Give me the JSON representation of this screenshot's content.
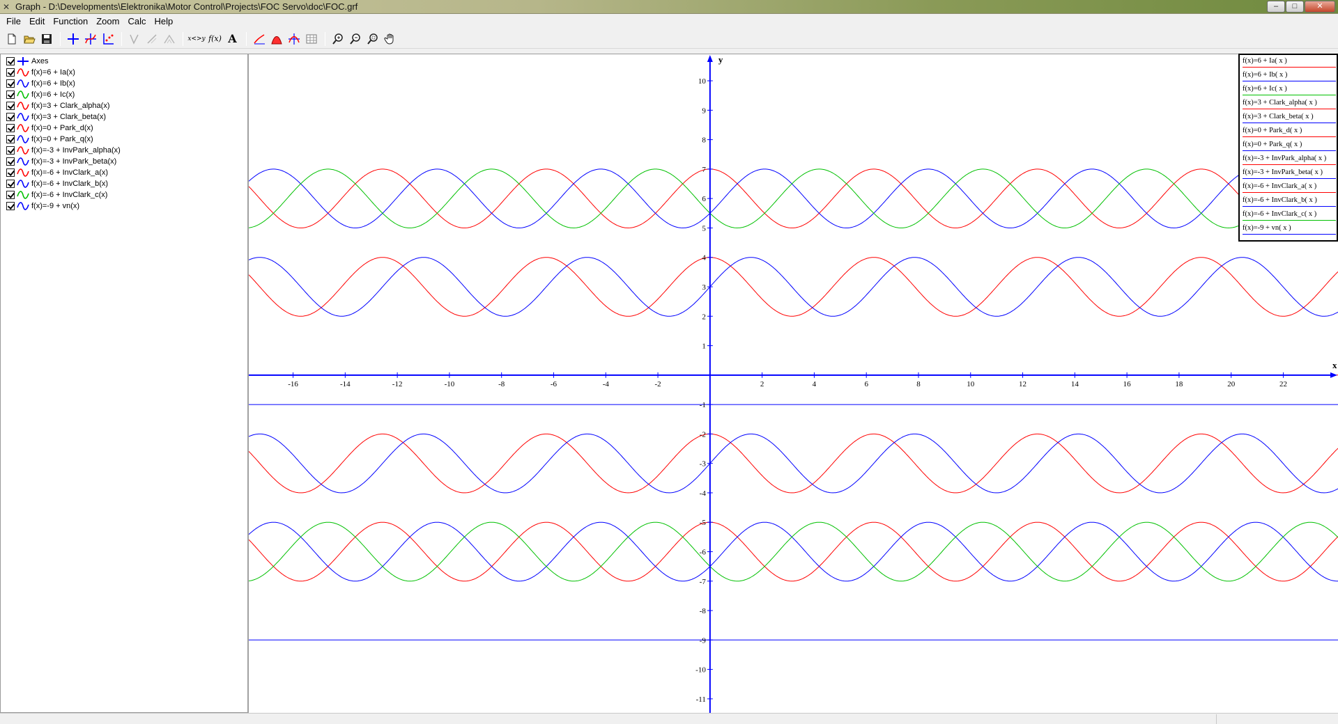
{
  "window": {
    "title": "Graph - D:\\Developments\\Elektronika\\Motor Control\\Projects\\FOC Servo\\doc\\FOC.grf",
    "minimize_label": "–",
    "maximize_label": "□",
    "close_label": "✕"
  },
  "menu": {
    "items": [
      "File",
      "Edit",
      "Function",
      "Zoom",
      "Calc",
      "Help"
    ]
  },
  "toolbar": {
    "swap_label": "x<>y",
    "fx_label": "f(x)",
    "text_label": "A",
    "buttons": [
      "new-icon",
      "open-icon",
      "save-icon",
      "insert-axes-icon",
      "insert-function-icon",
      "insert-point-series-icon",
      "tangent-icon",
      "shading-icon",
      "relation-icon",
      "swap-xy-icon",
      "fx-icon",
      "text-icon",
      "trendline-icon",
      "area-icon",
      "evaluate-icon",
      "table-icon",
      "zoom-in-icon",
      "zoom-out-icon",
      "zoom-window-icon",
      "pan-hand-icon"
    ]
  },
  "function_list": {
    "items": [
      {
        "label": "Axes",
        "color": "#0000ff",
        "icon": "axes-icon",
        "checked": true
      },
      {
        "label": "f(x)=6 + Ia(x)",
        "color": "#ff0000",
        "icon": "graph-icon",
        "checked": true
      },
      {
        "label": "f(x)=6 + Ib(x)",
        "color": "#0000ff",
        "icon": "graph-icon",
        "checked": true
      },
      {
        "label": "f(x)=6 + Ic(x)",
        "color": "#00c000",
        "icon": "graph-icon",
        "checked": true
      },
      {
        "label": "f(x)=3 + Clark_alpha(x)",
        "color": "#ff0000",
        "icon": "graph-icon",
        "checked": true
      },
      {
        "label": "f(x)=3 + Clark_beta(x)",
        "color": "#0000ff",
        "icon": "graph-icon",
        "checked": true
      },
      {
        "label": "f(x)=0 + Park_d(x)",
        "color": "#ff0000",
        "icon": "graph-icon",
        "checked": true
      },
      {
        "label": "f(x)=0 + Park_q(x)",
        "color": "#0000ff",
        "icon": "graph-icon",
        "checked": true
      },
      {
        "label": "f(x)=-3 + InvPark_alpha(x)",
        "color": "#ff0000",
        "icon": "graph-icon",
        "checked": true
      },
      {
        "label": "f(x)=-3 + InvPark_beta(x)",
        "color": "#0000ff",
        "icon": "graph-icon",
        "checked": true
      },
      {
        "label": "f(x)=-6 + InvClark_a(x)",
        "color": "#ff0000",
        "icon": "graph-icon",
        "checked": true
      },
      {
        "label": "f(x)=-6 + InvClark_b(x)",
        "color": "#0000ff",
        "icon": "graph-icon",
        "checked": true
      },
      {
        "label": "f(x)=-6 + InvClark_c(x)",
        "color": "#00c000",
        "icon": "graph-icon",
        "checked": true
      },
      {
        "label": "f(x)=-9 + vn(x)",
        "color": "#0000ff",
        "icon": "graph-icon",
        "checked": true
      }
    ]
  },
  "legend": {
    "items": [
      {
        "label": "f(x)=6 + Ia( x )",
        "color": "#ff0000"
      },
      {
        "label": "f(x)=6 + Ib( x )",
        "color": "#0000ff"
      },
      {
        "label": "f(x)=6 + Ic( x )",
        "color": "#00c000"
      },
      {
        "label": "f(x)=3 + Clark_alpha( x )",
        "color": "#ff0000"
      },
      {
        "label": "f(x)=3 + Clark_beta( x )",
        "color": "#0000ff"
      },
      {
        "label": "f(x)=0 + Park_d( x )",
        "color": "#ff0000"
      },
      {
        "label": "f(x)=0 + Park_q( x )",
        "color": "#0000ff"
      },
      {
        "label": "f(x)=-3 + InvPark_alpha( x )",
        "color": "#ff0000"
      },
      {
        "label": "f(x)=-3 + InvPark_beta( x )",
        "color": "#0000ff"
      },
      {
        "label": "f(x)=-6 + InvClark_a( x )",
        "color": "#ff0000"
      },
      {
        "label": "f(x)=-6 + InvClark_b( x )",
        "color": "#0000ff"
      },
      {
        "label": "f(x)=-6 + InvClark_c( x )",
        "color": "#00c000"
      },
      {
        "label": "f(x)=-9 + vn( x )",
        "color": "#0000ff"
      }
    ]
  },
  "chart_data": {
    "type": "line",
    "title": "",
    "xlabel": "x",
    "ylabel": "y",
    "xlim": [
      -17.7,
      24.1
    ],
    "ylim": [
      -11.5,
      10.9
    ],
    "x_ticks": [
      -16,
      -14,
      -12,
      -10,
      -8,
      -6,
      -4,
      -2,
      2,
      4,
      6,
      8,
      10,
      12,
      14,
      16,
      18,
      20,
      22
    ],
    "y_ticks": [
      10,
      9,
      8,
      7,
      6,
      5,
      4,
      3,
      2,
      1,
      -1,
      -2,
      -3,
      -4,
      -5,
      -6,
      -7,
      -8,
      -9,
      -10,
      -11
    ],
    "axis_color": "#0000ff",
    "period": 6.2832,
    "series": [
      {
        "name": "f(x)=6 + Ia( x )",
        "color": "#ff0000",
        "offset": 6,
        "amplitude": 1,
        "phase_deg": 90
      },
      {
        "name": "f(x)=6 + Ib( x )",
        "color": "#0000ff",
        "offset": 6,
        "amplitude": 1,
        "phase_deg": -30
      },
      {
        "name": "f(x)=6 + Ic( x )",
        "color": "#00c000",
        "offset": 6,
        "amplitude": 1,
        "phase_deg": 210
      },
      {
        "name": "f(x)=3 + Clark_alpha( x )",
        "color": "#ff0000",
        "offset": 3,
        "amplitude": 1,
        "phase_deg": 90
      },
      {
        "name": "f(x)=3 + Clark_beta( x )",
        "color": "#0000ff",
        "offset": 3,
        "amplitude": 1,
        "phase_deg": 0
      },
      {
        "name": "f(x)=0 + Park_d( x )",
        "color": "#ff0000",
        "offset": 0,
        "amplitude": 0,
        "phase_deg": 0
      },
      {
        "name": "f(x)=0 + Park_q( x )",
        "color": "#0000ff",
        "offset": -1,
        "amplitude": 0,
        "phase_deg": 0
      },
      {
        "name": "f(x)=-3 + InvPark_alpha( x )",
        "color": "#ff0000",
        "offset": -3,
        "amplitude": 1,
        "phase_deg": 90
      },
      {
        "name": "f(x)=-3 + InvPark_beta( x )",
        "color": "#0000ff",
        "offset": -3,
        "amplitude": 1,
        "phase_deg": 0
      },
      {
        "name": "f(x)=-6 + InvClark_a( x )",
        "color": "#ff0000",
        "offset": -6,
        "amplitude": 1,
        "phase_deg": 90
      },
      {
        "name": "f(x)=-6 + InvClark_b( x )",
        "color": "#0000ff",
        "offset": -6,
        "amplitude": 1,
        "phase_deg": -30
      },
      {
        "name": "f(x)=-6 + InvClark_c( x )",
        "color": "#00c000",
        "offset": -6,
        "amplitude": 1,
        "phase_deg": 210
      },
      {
        "name": "f(x)=-9 + vn( x )",
        "color": "#0000ff",
        "offset": -9,
        "amplitude": 0,
        "phase_deg": 0
      }
    ],
    "grid": false,
    "legend_position": "top-right"
  }
}
